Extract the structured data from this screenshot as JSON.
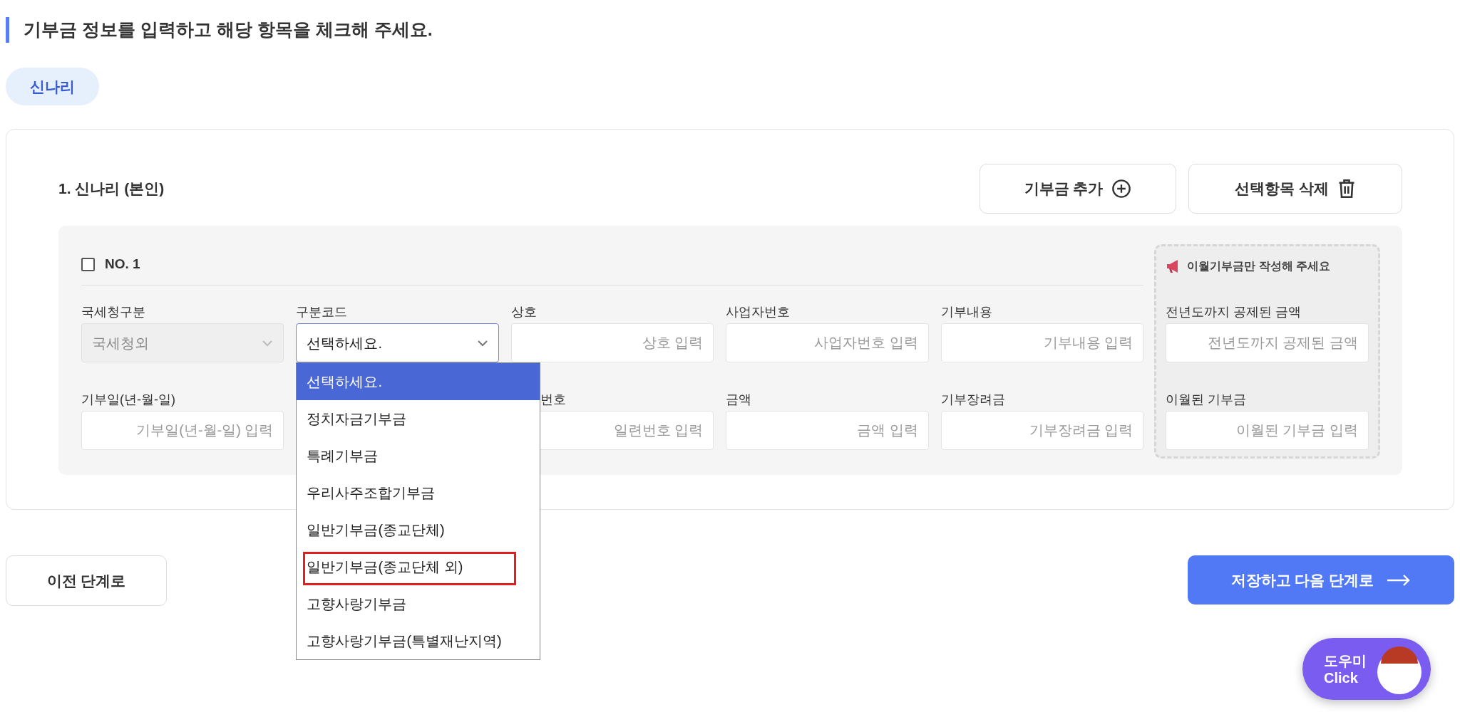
{
  "heading": "기부금 정보를 입력하고 해당 항목을 체크해 주세요.",
  "person_tabs": [
    {
      "label": "신나리",
      "selected": true
    }
  ],
  "section": {
    "title": "1. 신나리 (본인)",
    "buttons": [
      {
        "label": "기부금 추가",
        "kind": "add"
      },
      {
        "label": "선택항목 삭제",
        "kind": "delete"
      }
    ]
  },
  "entry": {
    "checkbox": {
      "label": "NO. 1",
      "checked": false
    },
    "notice": "이월기부금만 작성해 주세요",
    "rows": [
      [
        {
          "kind": "select",
          "label": "국세청구분",
          "value": "국세청외",
          "disabled": true,
          "open": false
        },
        {
          "kind": "select",
          "label": "구분코드",
          "value": "선택하세요.",
          "disabled": false,
          "open": true
        },
        {
          "kind": "input",
          "label": "상호",
          "placeholder": "상호 입력"
        },
        {
          "kind": "input",
          "label": "사업자번호",
          "placeholder": "사업자번호 입력"
        },
        {
          "kind": "input",
          "label": "기부내용",
          "placeholder": "기부내용 입력"
        }
      ],
      [
        {
          "kind": "input",
          "label": "기부일(년-월-일)",
          "placeholder": "기부일(년-월-일) 입력"
        },
        {
          "kind": "covered"
        },
        {
          "kind": "input",
          "label": "번호",
          "label_cut": true,
          "placeholder": "일련번호 입력"
        },
        {
          "kind": "input",
          "label": "금액",
          "placeholder": "금액 입력"
        },
        {
          "kind": "input",
          "label": "기부장려금",
          "placeholder": "기부장려금 입력"
        }
      ]
    ],
    "carryover": [
      {
        "kind": "input",
        "label": "전년도까지 공제된 금액",
        "placeholder": "전년도까지 공제된 금액"
      },
      {
        "kind": "input",
        "label": "이월된 기부금",
        "placeholder": "이월된 기부금 입력"
      }
    ]
  },
  "dropdown_options": [
    {
      "label": "선택하세요.",
      "selected": true,
      "highlighted": false
    },
    {
      "label": "정치자금기부금",
      "selected": false,
      "highlighted": false
    },
    {
      "label": "특례기부금",
      "selected": false,
      "highlighted": false
    },
    {
      "label": "우리사주조합기부금",
      "selected": false,
      "highlighted": false
    },
    {
      "label": "일반기부금(종교단체)",
      "selected": false,
      "highlighted": false
    },
    {
      "label": "일반기부금(종교단체 외)",
      "selected": false,
      "highlighted": true
    },
    {
      "label": "고향사랑기부금",
      "selected": false,
      "highlighted": false
    },
    {
      "label": "고향사랑기부금(특별재난지역)",
      "selected": false,
      "highlighted": false
    }
  ],
  "footer": {
    "prev": "이전 단계로",
    "next": "저장하고 다음 단계로"
  },
  "helper": {
    "lines": [
      "도우미",
      "Click"
    ]
  }
}
